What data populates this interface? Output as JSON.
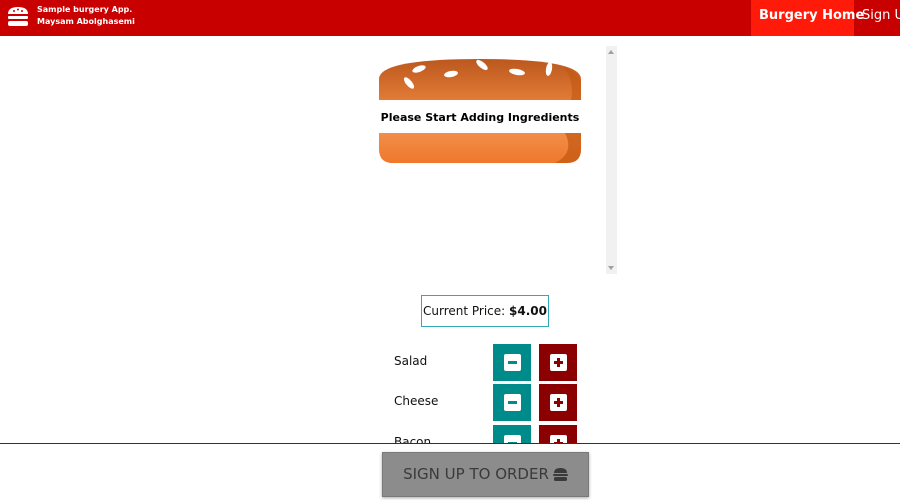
{
  "navbar": {
    "brand_line1": "Sample burgery App.",
    "brand_line2": "Maysam Abolghasemi",
    "logo_icon": "burger-icon",
    "links": [
      {
        "label": "Burgery Home",
        "active": true
      },
      {
        "label": "Sign Up",
        "active": false
      }
    ]
  },
  "burger": {
    "message": "Please Start Adding Ingredients"
  },
  "price": {
    "label": "Current Price: ",
    "value": "$4.00"
  },
  "controls": [
    {
      "label": "Salad"
    },
    {
      "label": "Cheese"
    },
    {
      "label": "Bacon"
    }
  ],
  "order_button": {
    "label": "SIGN UP TO ORDER",
    "icon": "burger-icon"
  },
  "colors": {
    "nav_bg": "#c80000",
    "nav_active": "#ff1a0a",
    "less_btn": "#008b8b",
    "more_btn": "#8b0000",
    "price_border": "#30a9b8",
    "order_btn": "#8c8c8c"
  }
}
